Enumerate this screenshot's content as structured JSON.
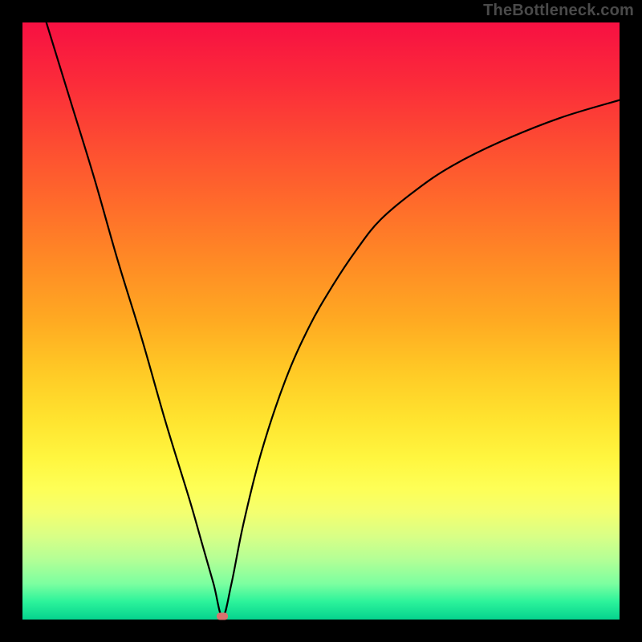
{
  "watermark": "TheBottleneck.com",
  "chart_data": {
    "type": "line",
    "title": "",
    "xlabel": "",
    "ylabel": "",
    "xlim": [
      0,
      100
    ],
    "ylim": [
      0,
      100
    ],
    "grid": false,
    "series": [
      {
        "name": "curve",
        "x": [
          4,
          8,
          12,
          16,
          20,
          24,
          28,
          30,
          32,
          33.5,
          35,
          37,
          40,
          44,
          48,
          52,
          56,
          60,
          66,
          72,
          80,
          90,
          100
        ],
        "y": [
          100,
          87,
          74,
          60,
          47,
          33,
          20,
          13,
          6,
          0.5,
          6,
          16,
          28,
          40,
          49,
          56,
          62,
          67,
          72,
          76,
          80,
          84,
          87
        ]
      }
    ],
    "marker": {
      "x": 33.5,
      "y": 0.5,
      "color": "#d9726e"
    },
    "background": "rainbow-vertical-gradient",
    "axes_visible": false
  },
  "geom": {
    "pad": 28,
    "inner": 744,
    "total": 800
  }
}
